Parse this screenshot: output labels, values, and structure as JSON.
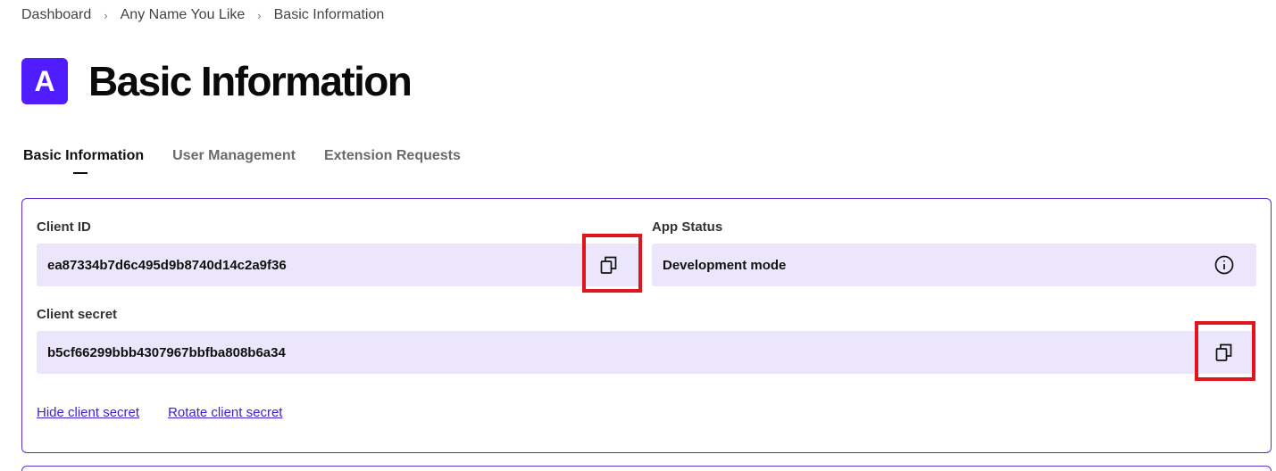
{
  "breadcrumb": {
    "items": [
      "Dashboard",
      "Any Name You Like",
      "Basic Information"
    ],
    "separator": "›"
  },
  "header": {
    "avatar_letter": "A",
    "title": "Basic Information"
  },
  "tabs": [
    {
      "label": "Basic Information",
      "active": true
    },
    {
      "label": "User Management",
      "active": false
    },
    {
      "label": "Extension Requests",
      "active": false
    }
  ],
  "credentials": {
    "client_id": {
      "label": "Client ID",
      "value": "ea87334b7d6c495d9b8740d14c2a9f36",
      "action_icon": "copy-icon"
    },
    "app_status": {
      "label": "App Status",
      "value": "Development mode",
      "action_icon": "info-icon"
    },
    "client_secret": {
      "label": "Client secret",
      "value": "b5cf66299bbb4307967bbfba808b6a34",
      "action_icon": "copy-icon"
    },
    "links": {
      "hide": "Hide client secret",
      "rotate": "Rotate client secret"
    }
  },
  "colors": {
    "brand": "#4f1dff",
    "field_background": "#ebe6fb",
    "card_border": "#5a2fcf",
    "link": "#3b1fd6",
    "highlight_box": "#e0161e"
  }
}
